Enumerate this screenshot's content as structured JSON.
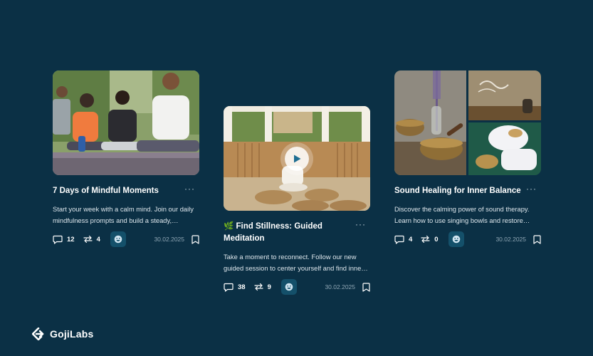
{
  "cards": [
    {
      "title": "7 Days of Mindful Moments",
      "description": "Start your week with a calm mind. Join our daily mindfulness prompts and build a steady, peaceful routine.",
      "comments": "12",
      "reposts": "4",
      "date": "30.02.2025",
      "image": "group-yoga-meditation-photo"
    },
    {
      "title_emoji": "🌿",
      "title": "Find Stillness: Guided Meditation",
      "description": "Take a moment to reconnect. Follow our new guided session to center yourself and find inner calm.",
      "comments": "38",
      "reposts": "9",
      "date": "30.02.2025",
      "image": "meditation-pavilion-video"
    },
    {
      "title": "Sound Healing for Inner Balance",
      "description": "Discover the calming power of sound therapy. Learn how to use singing bowls and restore balance.",
      "comments": "4",
      "reposts": "0",
      "date": "30.02.2025",
      "image": "singing-bowls-collage"
    }
  ],
  "brand": {
    "name": "GojiLabs"
  },
  "icons": {
    "comment": "comment-icon",
    "repost": "repost-icon",
    "reaction": "smiley-icon",
    "bookmark": "bookmark-icon",
    "more": "more-icon",
    "play": "play-icon"
  },
  "colors": {
    "background": "#0b3045",
    "reaction_bg": "#14506a",
    "date": "#8fa6b4"
  }
}
